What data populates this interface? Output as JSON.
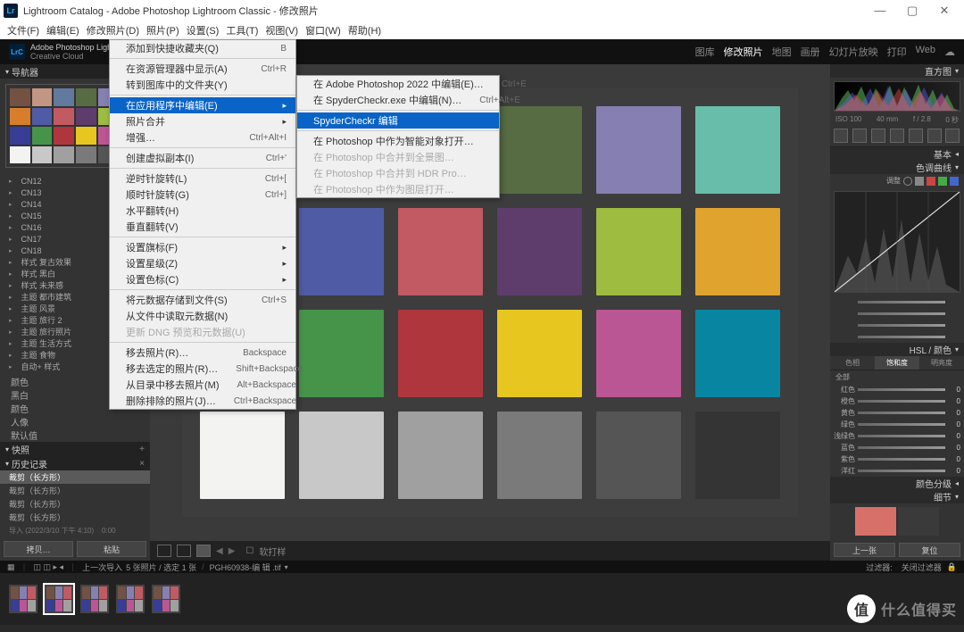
{
  "window": {
    "title": "Lightroom Catalog - Adobe Photoshop Lightroom Classic - 修改照片"
  },
  "menubar": [
    "文件(F)",
    "编辑(E)",
    "修改照片(D)",
    "照片(P)",
    "设置(S)",
    "工具(T)",
    "视图(V)",
    "窗口(W)",
    "帮助(H)"
  ],
  "cc": {
    "line1": "Adobe Photoshop Lightroom Classic",
    "line2": "Creative Cloud"
  },
  "modules": [
    {
      "label": "图库",
      "active": false
    },
    {
      "label": "修改照片",
      "active": true
    },
    {
      "label": "地图",
      "active": false
    },
    {
      "label": "画册",
      "active": false
    },
    {
      "label": "幻灯片放映",
      "active": false
    },
    {
      "label": "打印",
      "active": false
    },
    {
      "label": "Web",
      "active": false
    }
  ],
  "nav_header": "导航器",
  "folders": [
    "CN12",
    "CN13",
    "CN14",
    "CN15",
    "CN16",
    "CN17",
    "CN18",
    "样式 复古效果",
    "样式 黑白",
    "样式 未来感",
    "主题 都市建筑",
    "主题 风景",
    "主题 旅行 2",
    "主题 旅行照片",
    "主题 生活方式",
    "主题 食物",
    "自动+ 样式"
  ],
  "more_headers": [
    "颜色",
    "黑白",
    "颜色",
    "人像",
    "默认值"
  ],
  "snapshot_header": "快照",
  "history_header": "历史记录",
  "history_items": [
    "裁剪（长方形）",
    "裁剪（长方形）",
    "裁剪（长方形）",
    "裁剪（长方形）"
  ],
  "left_buttons": {
    "copy": "拷贝…",
    "paste": "粘贴"
  },
  "dropdown1": [
    {
      "t": "item",
      "label": "添加到快捷收藏夹(Q)",
      "sc": "B"
    },
    {
      "t": "sep"
    },
    {
      "t": "item",
      "label": "在资源管理器中显示(A)",
      "sc": "Ctrl+R"
    },
    {
      "t": "item",
      "label": "转到图库中的文件夹(Y)"
    },
    {
      "t": "sep"
    },
    {
      "t": "item",
      "label": "在应用程序中编辑(E)",
      "hl": true,
      "arrow": true
    },
    {
      "t": "item",
      "label": "照片合并",
      "arrow": true
    },
    {
      "t": "item",
      "label": "增强…",
      "sc": "Ctrl+Alt+I"
    },
    {
      "t": "sep"
    },
    {
      "t": "item",
      "label": "创建虚拟副本(I)",
      "sc": "Ctrl+'"
    },
    {
      "t": "sep"
    },
    {
      "t": "item",
      "label": "逆时针旋转(L)",
      "sc": "Ctrl+["
    },
    {
      "t": "item",
      "label": "顺时针旋转(G)",
      "sc": "Ctrl+]"
    },
    {
      "t": "item",
      "label": "水平翻转(H)"
    },
    {
      "t": "item",
      "label": "垂直翻转(V)"
    },
    {
      "t": "sep"
    },
    {
      "t": "item",
      "label": "设置旗标(F)",
      "arrow": true
    },
    {
      "t": "item",
      "label": "设置星级(Z)",
      "arrow": true
    },
    {
      "t": "item",
      "label": "设置色标(C)",
      "arrow": true
    },
    {
      "t": "sep"
    },
    {
      "t": "item",
      "label": "将元数据存储到文件(S)",
      "sc": "Ctrl+S"
    },
    {
      "t": "item",
      "label": "从文件中读取元数据(N)"
    },
    {
      "t": "item",
      "label": "更新 DNG 预览和元数据(U)",
      "dis": true
    },
    {
      "t": "sep"
    },
    {
      "t": "item",
      "label": "移去照片(R)…",
      "sc": "Backspace"
    },
    {
      "t": "item",
      "label": "移去选定的照片(R)…",
      "sc": "Shift+Backspace"
    },
    {
      "t": "item",
      "label": "从目录中移去照片(M)",
      "sc": "Alt+Backspace"
    },
    {
      "t": "item",
      "label": "删除排除的照片(J)…",
      "sc": "Ctrl+Backspace"
    }
  ],
  "dropdown2": [
    {
      "t": "item",
      "label": "在 Adobe Photoshop 2022 中编辑(E)…",
      "sc": "Ctrl+E"
    },
    {
      "t": "item",
      "label": "在 SpyderCheckr.exe 中编辑(N)…",
      "sc": "Ctrl+Alt+E"
    },
    {
      "t": "sep"
    },
    {
      "t": "item",
      "label": "SpyderCheckr 编辑",
      "hl": true
    },
    {
      "t": "sep"
    },
    {
      "t": "item",
      "label": "在 Photoshop 中作为智能对象打开…"
    },
    {
      "t": "item",
      "label": "在 Photoshop 中合并到全景图…",
      "dis": true
    },
    {
      "t": "item",
      "label": "在 Photoshop 中合并到 HDR Pro…",
      "dis": true
    },
    {
      "t": "item",
      "label": "在 Photoshop 中作为图层打开…",
      "dis": true
    }
  ],
  "right": {
    "histogram_header": "直方图",
    "hist_info": {
      "iso": "ISO 100",
      "focal": "40 mm",
      "f": "f / 2.8",
      "exp": "0 秒"
    },
    "basic": "基本",
    "curve": "色调曲线",
    "color_adjust": "调整",
    "hsl": "HSL / 颜色",
    "tabs": [
      "色相",
      "饱和度",
      "明亮度"
    ],
    "hue_rows": [
      "红色",
      "橙色",
      "黄色",
      "绿色",
      "浅绿色",
      "蓝色",
      "紫色",
      "洋红"
    ],
    "all_word": "全部",
    "grading": "颜色分级",
    "detail": "细节",
    "prev": "上一张",
    "reset": "复位"
  },
  "toolbar_bottom": {
    "softproof": "软打样"
  },
  "status": {
    "prev": "上一次导入",
    "count": "5 张照片 / 选定 1 张",
    "file": "PGH60938-编 辑 .tif",
    "filter": "过滤器:",
    "off": "关闭过滤器"
  },
  "colorchecker": [
    "#735244",
    "#c29682",
    "#627a9d",
    "#576c43",
    "#8580b1",
    "#67bdaa",
    "#d67e2c",
    "#505ba6",
    "#c15a63",
    "#5e3c6c",
    "#9dbc40",
    "#e0a32e",
    "#383d96",
    "#469449",
    "#af363c",
    "#e7c71f",
    "#bb5695",
    "#0885a1",
    "#f3f3f2",
    "#c8c8c8",
    "#a0a0a0",
    "#7a7a7a",
    "#555555",
    "#343434"
  ],
  "watermark": "什么值得买"
}
